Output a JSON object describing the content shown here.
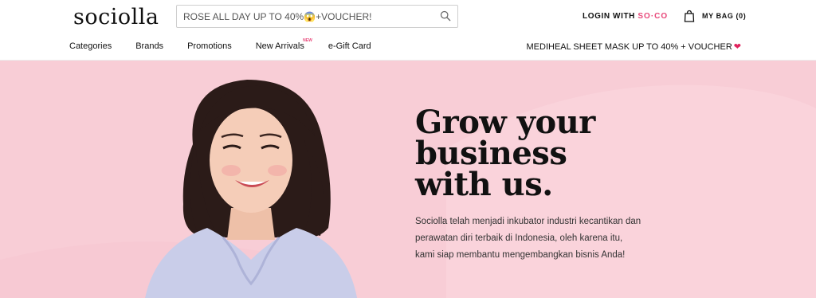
{
  "header": {
    "logo": "sociolla",
    "search": {
      "placeholder": "ROSE ALL DAY UP TO 40%😱+VOUCHER!"
    },
    "login": {
      "label": "LOGIN WITH ",
      "brand": "SO·CO"
    },
    "bag": {
      "label": "MY BAG (0)"
    }
  },
  "nav": {
    "items": [
      {
        "label": "Categories"
      },
      {
        "label": "Brands"
      },
      {
        "label": "Promotions"
      },
      {
        "label": "New Arrivals",
        "badge": "NEW"
      },
      {
        "label": "e-Gift Card"
      }
    ],
    "promo": "MEDIHEAL SHEET MASK UP TO 40% + VOUCHER"
  },
  "hero": {
    "title_lines": [
      "Grow your",
      "business",
      "with us."
    ],
    "desc_lines": [
      "Sociolla telah menjadi inkubator industri kecantikan dan",
      "perawatan diri terbaik di Indonesia, oleh karena itu,",
      "kami siap membantu mengembangkan bisnis Anda!"
    ]
  },
  "colors": {
    "hero_bg": "#f8cdd6",
    "accent": "#e8487a",
    "heart": "#e0245e"
  }
}
